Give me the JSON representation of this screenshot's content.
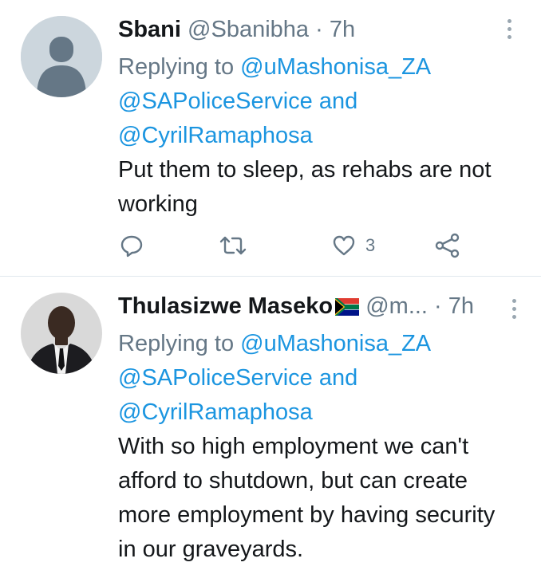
{
  "tweets": [
    {
      "name": "Sbani",
      "handle": "@Sbanibha",
      "separator": " · ",
      "time": "7h",
      "replying_prefix": "Replying to ",
      "mention_1": "@uMashonisa_ZA",
      "mention_2": "@SAPoliceService",
      "and_word": " and",
      "mention_3": "@CyrilRamaphosa",
      "text": "Put them to sleep, as rehabs are not working",
      "actions": {
        "reply_icon": "reply-icon",
        "retweet_icon": "retweet-icon",
        "like_icon": "heart-icon",
        "like_count": "3",
        "share_icon": "share-icon"
      }
    },
    {
      "name": "Thulasizwe Maseko",
      "flag_icon": "south-africa-flag-emoji",
      "handle": "@m...",
      "separator": " · ",
      "time": "7h",
      "replying_prefix": "Replying to ",
      "mention_1": "@uMashonisa_ZA",
      "mention_2": "@SAPoliceService",
      "and_word": " and",
      "mention_3": "@CyrilRamaphosa",
      "text": "With so high employment we can't afford to shutdown, but can create more employment by having security in our graveyards."
    }
  ],
  "colors": {
    "link": "#1b95e0",
    "secondary_text": "#657786",
    "primary_text": "#14171a",
    "divider": "#e1e8ed"
  }
}
